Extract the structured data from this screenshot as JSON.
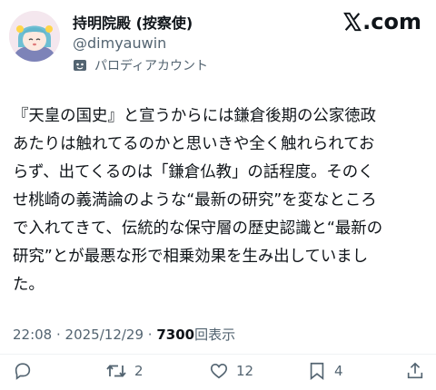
{
  "author": {
    "name": "持明院殿 (按察使)",
    "handle": "@dimyauwin",
    "label": "パロディアカウント"
  },
  "brand": {
    "logo_text": ".com"
  },
  "post": {
    "text": "『天皇の国史』と宣うからには鎌倉後期の公家徳政\nあたりは触れてるのかと思いきや全く触れられてお\nらず、出てくるのは「鎌倉仏教」の話程度。そのく\nせ桃崎の義満論のような“最新の研究”を変なところ\nで入れてきて、伝統的な保守層の歴史認識と“最新の\n研究”とが最悪な形で相乗効果を生み出していまし\nた。"
  },
  "meta": {
    "time": "22:08",
    "separator": " · ",
    "date": "2025/12/29",
    "views_count": "7300",
    "views_label": "回表示"
  },
  "actions": {
    "reply": {
      "icon": "reply-icon",
      "count": ""
    },
    "repost": {
      "icon": "repost-icon",
      "count": "2"
    },
    "like": {
      "icon": "heart-icon",
      "count": "12"
    },
    "bookmark": {
      "icon": "bookmark-icon",
      "count": "4"
    },
    "share": {
      "icon": "share-icon",
      "count": ""
    }
  },
  "colors": {
    "text": "#0f1419",
    "secondary": "#536471",
    "divider": "#eff3f4"
  }
}
